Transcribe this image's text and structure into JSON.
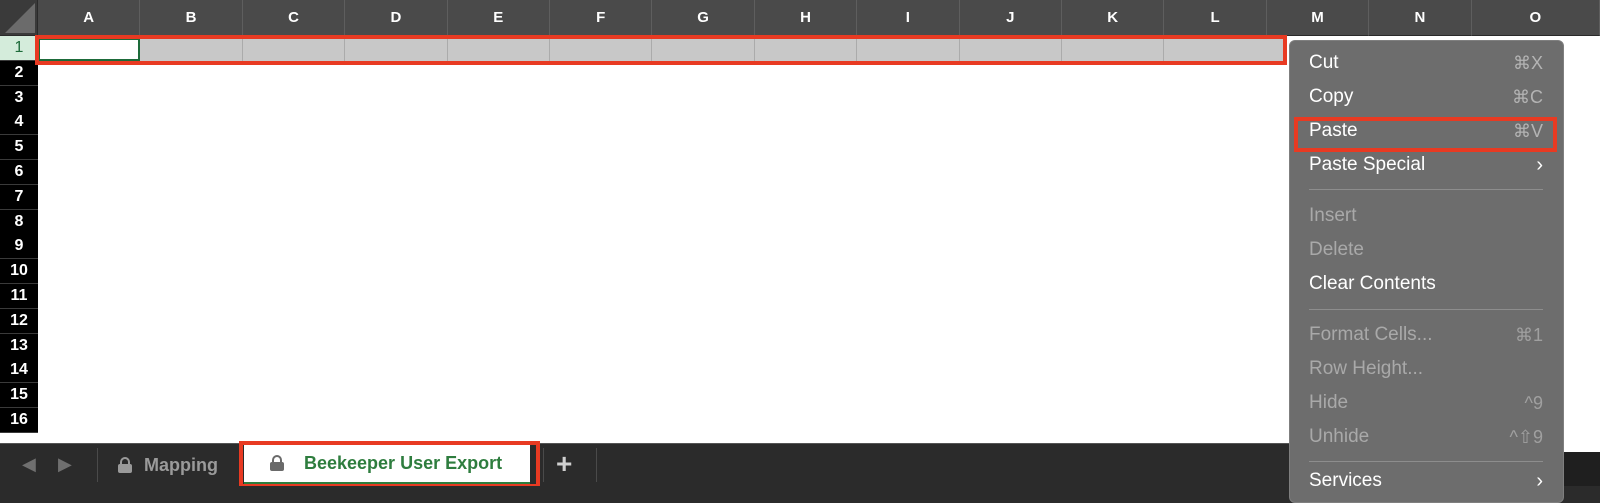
{
  "columns": [
    "A",
    "B",
    "C",
    "D",
    "E",
    "F",
    "G",
    "H",
    "I",
    "J",
    "K",
    "L",
    "M",
    "N",
    "O"
  ],
  "rows": [
    "1",
    "2",
    "3",
    "4",
    "5",
    "6",
    "7",
    "8",
    "9",
    "10",
    "11",
    "12",
    "13",
    "14",
    "15",
    "16"
  ],
  "tabs": {
    "mapping": "Mapping",
    "export": "Beekeeper User Export",
    "add": "+"
  },
  "context_menu": {
    "cut": {
      "label": "Cut",
      "shortcut": "⌘X"
    },
    "copy": {
      "label": "Copy",
      "shortcut": "⌘C"
    },
    "paste": {
      "label": "Paste",
      "shortcut": "⌘V"
    },
    "paste_special": {
      "label": "Paste Special"
    },
    "insert": {
      "label": "Insert"
    },
    "delete": {
      "label": "Delete"
    },
    "clear_contents": {
      "label": "Clear Contents"
    },
    "format_cells": {
      "label": "Format Cells...",
      "shortcut": "⌘1"
    },
    "row_height": {
      "label": "Row Height..."
    },
    "hide": {
      "label": "Hide",
      "shortcut": "^9"
    },
    "unhide": {
      "label": "Unhide",
      "shortcut": "^⇧9"
    },
    "services": {
      "label": "Services"
    }
  },
  "colors": {
    "highlight": "#e83a22",
    "accent": "#2e7d3e"
  }
}
